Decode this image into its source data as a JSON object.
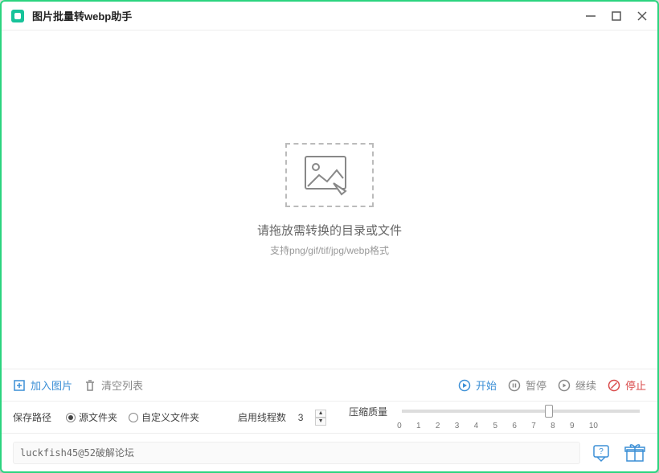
{
  "window": {
    "title": "图片批量转webp助手"
  },
  "dropzone": {
    "main_text": "请拖放需转换的目录或文件",
    "sub_text": "支持png/gif/tif/jpg/webp格式"
  },
  "toolbar": {
    "add_label": "加入图片",
    "clear_label": "清空列表",
    "start_label": "开始",
    "pause_label": "暂停",
    "resume_label": "继续",
    "stop_label": "停止"
  },
  "settings": {
    "save_path_label": "保存路径",
    "radio_source": "源文件夹",
    "radio_custom": "自定义文件夹",
    "radio_selected": "source",
    "threads_label": "启用线程数",
    "threads_value": "3",
    "quality_label": "压缩质量",
    "quality_value": 6,
    "quality_ticks": [
      "0",
      "1",
      "2",
      "3",
      "4",
      "5",
      "6",
      "7",
      "8",
      "9",
      "10"
    ]
  },
  "status": {
    "text": "luckfish45@52破解论坛"
  }
}
